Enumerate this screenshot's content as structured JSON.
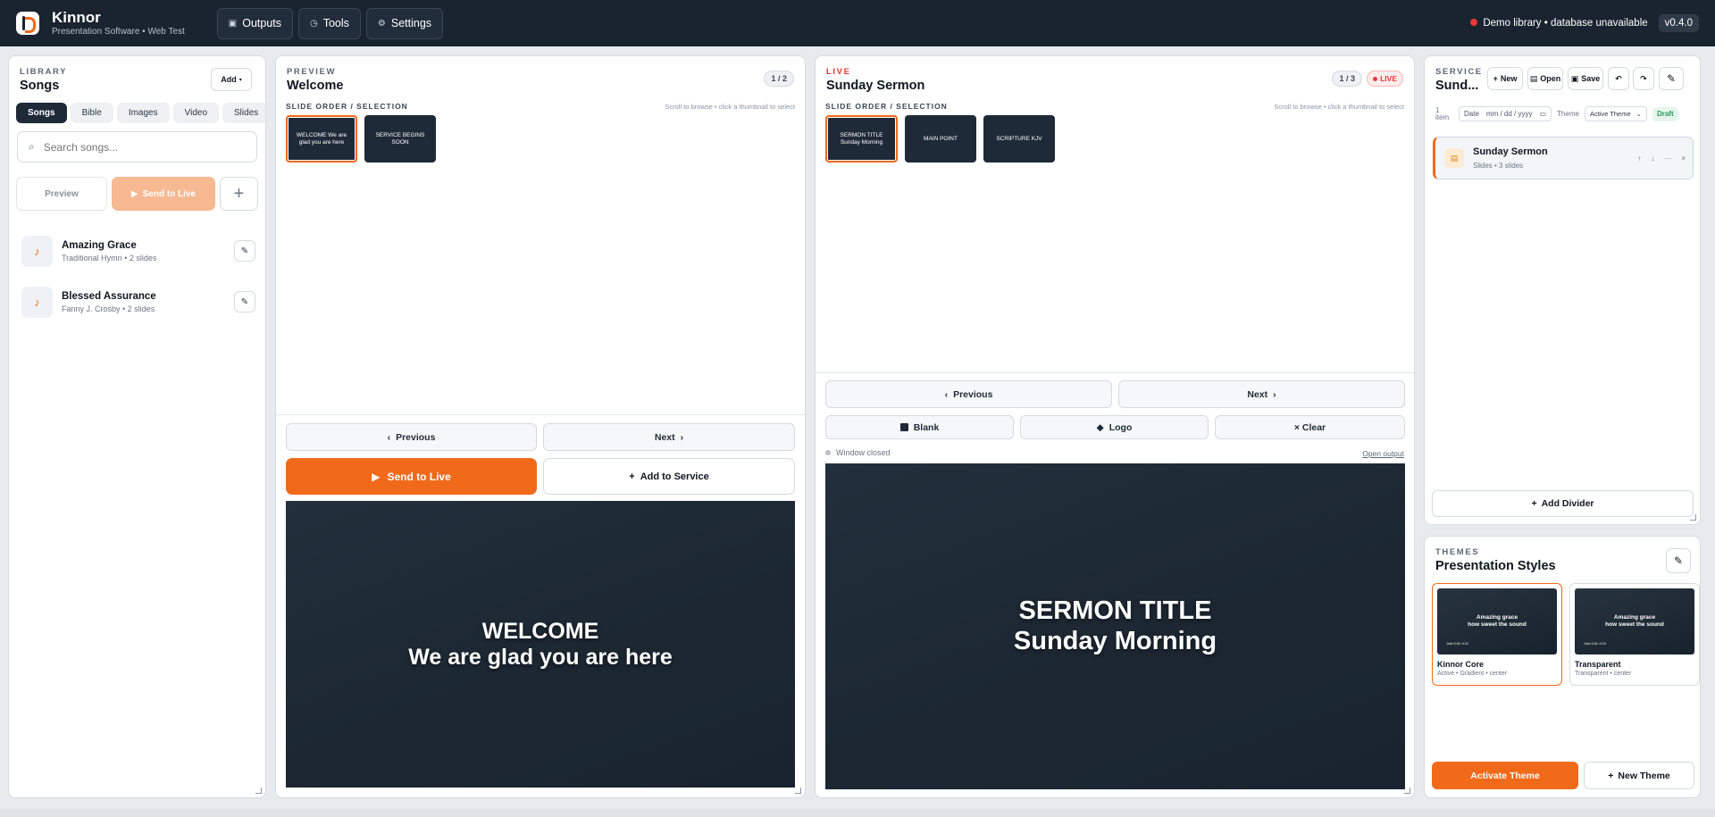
{
  "header": {
    "app_name": "Kinnor",
    "app_subtitle": "Presentation Software • Web Test",
    "nav": [
      {
        "label": "Outputs",
        "icon": "monitor-icon"
      },
      {
        "label": "Tools",
        "icon": "clock-icon"
      },
      {
        "label": "Settings",
        "icon": "gear-icon"
      }
    ],
    "status_text": "Demo library • database unavailable",
    "status_color": "#e53935",
    "version": "v0.4.0"
  },
  "library": {
    "eyebrow": "LIBRARY",
    "title": "Songs",
    "add_label": "Add",
    "tabs": [
      "Songs",
      "Bible",
      "Images",
      "Video",
      "Slides"
    ],
    "active_tab": "Songs",
    "search_placeholder": "Search songs...",
    "preview_label": "Preview",
    "send_live_label": "Send to Live",
    "songs": [
      {
        "title": "Amazing Grace",
        "subtitle": "Traditional Hymn • 2 slides"
      },
      {
        "title": "Blessed Assurance",
        "subtitle": "Fanny J. Crosby • 2 slides"
      }
    ]
  },
  "preview": {
    "eyebrow": "PREVIEW",
    "title": "Welcome",
    "counter": "1 / 2",
    "slide_order_label": "SLIDE ORDER / SELECTION",
    "slide_order_hint": "Scroll to browse • click a thumbnail to select",
    "thumbs": [
      "WELCOME We are glad you are here",
      "SERVICE BEGINS SOON"
    ],
    "prev_label": "Previous",
    "next_label": "Next",
    "send_live_label": "Send to Live",
    "add_service_label": "Add to Service",
    "screen_line1": "WELCOME",
    "screen_line2": "We are glad you are here"
  },
  "live": {
    "eyebrow": "LIVE",
    "title": "Sunday Sermon",
    "counter": "1 / 3",
    "badge": "LIVE",
    "slide_order_label": "SLIDE ORDER / SELECTION",
    "slide_order_hint": "Scroll to browse • click a thumbnail to select",
    "thumbs": [
      "SERMON TITLE Sunday Morning",
      "MAIN POINT",
      "SCRIPTURE KJV"
    ],
    "prev_label": "Previous",
    "next_label": "Next",
    "blank_label": "Blank",
    "logo_label": "Logo",
    "clear_label": "× Clear",
    "window_status": "Window closed",
    "open_output": "Open output",
    "screen_line1": "SERMON TITLE",
    "screen_line2": "Sunday Morning"
  },
  "service": {
    "eyebrow": "SERVICE",
    "title": "Sund...",
    "new_label": "New",
    "open_label": "Open",
    "save_label": "Save",
    "item_count": "1 item",
    "date_label": "Date",
    "date_placeholder": "mm / dd / yyyy",
    "theme_label": "Theme",
    "theme_value": "Active Theme",
    "draft_label": "Draft",
    "items": [
      {
        "title": "Sunday Sermon",
        "subtitle": "Slides • 3 slides"
      }
    ],
    "add_divider_label": "Add Divider"
  },
  "themes": {
    "eyebrow": "THEMES",
    "title": "Presentation Styles",
    "cards": [
      {
        "preview_line1": "Amazing grace",
        "preview_line2": "how sweet the sound",
        "preview_ref": "John 3:16 • KJV",
        "name": "Kinnor Core",
        "sub": "Active • Gradient • center"
      },
      {
        "preview_line1": "Amazing grace",
        "preview_line2": "how sweet the sound",
        "preview_ref": "John 3:16 • KJV",
        "name": "Transparent",
        "sub": "Transparent • center"
      }
    ],
    "activate_label": "Activate Theme",
    "new_theme_label": "New Theme"
  },
  "colors": {
    "accent": "#f06a1a",
    "topbar": "#1a2330",
    "live": "#e53935"
  }
}
